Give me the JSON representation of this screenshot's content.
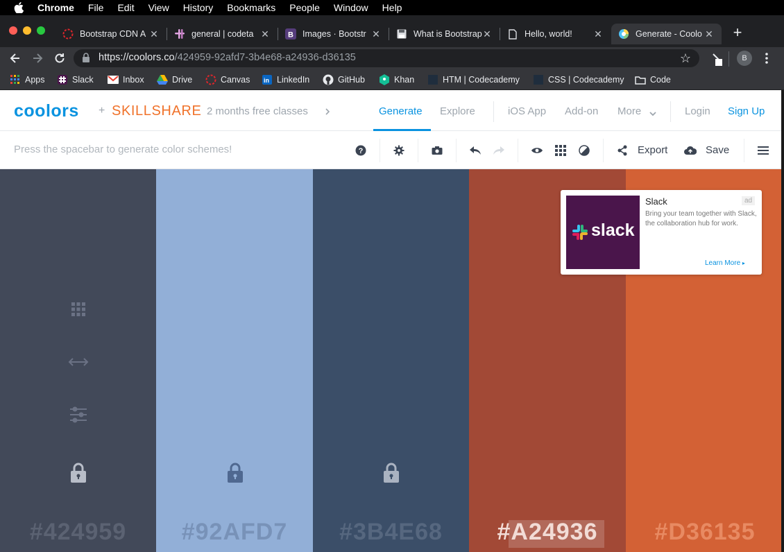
{
  "menubar": {
    "app": "Chrome",
    "items": [
      "File",
      "Edit",
      "View",
      "History",
      "Bookmarks",
      "People",
      "Window",
      "Help"
    ]
  },
  "tabs": [
    {
      "title": "Bootstrap CDN A",
      "icon": "bootstrapcdn-icon"
    },
    {
      "title": "general | codeta",
      "icon": "slack-icon"
    },
    {
      "title": "Images · Bootstr",
      "icon": "bootstrap-icon"
    },
    {
      "title": "What is Bootstrap",
      "icon": "floppy-icon"
    },
    {
      "title": "Hello, world!",
      "icon": "page-icon"
    },
    {
      "title": "Generate - Coolo",
      "icon": "coolors-icon"
    }
  ],
  "browser": {
    "url_host": "https://coolors.co",
    "url_path": "/424959-92afd7-3b4e68-a24936-d36135",
    "profile_initial": "B"
  },
  "bookmarks": [
    {
      "label": "Apps",
      "icon": "apps-grid-icon"
    },
    {
      "label": "Slack",
      "icon": "slack-icon"
    },
    {
      "label": "Inbox",
      "icon": "gmail-icon"
    },
    {
      "label": "Drive",
      "icon": "drive-icon"
    },
    {
      "label": "Canvas",
      "icon": "canvas-icon"
    },
    {
      "label": "LinkedIn",
      "icon": "linkedin-icon"
    },
    {
      "label": "GitHub",
      "icon": "github-icon"
    },
    {
      "label": "Khan",
      "icon": "khan-icon"
    },
    {
      "label": "HTM | Codecademy",
      "icon": "codecademy-icon"
    },
    {
      "label": "CSS | Codecademy",
      "icon": "codecademy-icon"
    },
    {
      "label": "Code",
      "icon": "folder-icon"
    }
  ],
  "header": {
    "logo": "coolors",
    "plus": "+",
    "partner": "SKILLSHARE",
    "promo": "2 months free classes",
    "nav": {
      "generate": "Generate",
      "explore": "Explore",
      "ios": "iOS App",
      "addon": "Add-on",
      "more": "More",
      "login": "Login",
      "signup": "Sign Up"
    }
  },
  "toolbar": {
    "hint": "Press the spacebar to generate color schemes!",
    "export": "Export",
    "save": "Save"
  },
  "palette": [
    {
      "hex": "#424959",
      "color": "#424959",
      "text_color": "#5b6272"
    },
    {
      "hex": "#92AFD7",
      "color": "#92AFD7",
      "text_color": "#7892b8"
    },
    {
      "hex": "#3B4E68",
      "color": "#3B4E68",
      "text_color": "#56677f"
    },
    {
      "hex": "#A24936",
      "color": "#A24936",
      "text_color": "#f2dcd6"
    },
    {
      "hex": "#D36135",
      "color": "#D36135",
      "text_color": "#e88a62"
    }
  ],
  "ad": {
    "title": "Slack",
    "badge": "ad",
    "logo_text": "slack",
    "body": "Bring your team together with Slack, the collaboration hub for work.",
    "cta": "Learn More"
  },
  "colors": {
    "accent": "#0a93e0",
    "skillshare": "#f0722a",
    "slack_purple": "#4a154b"
  }
}
